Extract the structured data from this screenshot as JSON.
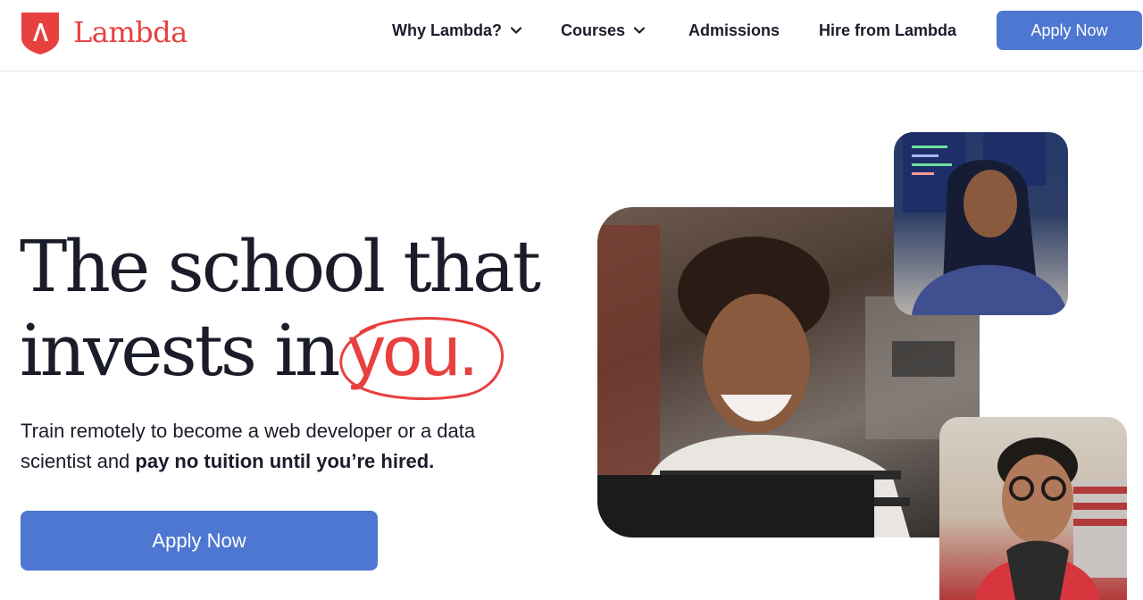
{
  "brand": {
    "name": "Lambda",
    "accent_color": "#e8403f",
    "button_color": "#4d77d0"
  },
  "nav": {
    "items": [
      {
        "label": "Why Lambda?",
        "has_dropdown": true
      },
      {
        "label": "Courses",
        "has_dropdown": true
      },
      {
        "label": "Admissions",
        "has_dropdown": false
      },
      {
        "label": "Hire from Lambda",
        "has_dropdown": false
      }
    ],
    "cta_label": "Apply Now"
  },
  "hero": {
    "title_line1": "The school that",
    "title_line2": "invests in",
    "title_highlight": "you.",
    "subtext_plain": "Train remotely to become a web developer or a data scientist and ",
    "subtext_bold": "pay no tuition until you’re hired.",
    "cta_label": "Apply Now"
  },
  "photos": [
    {
      "name": "student-laptop-photo"
    },
    {
      "name": "student-coding-photo"
    },
    {
      "name": "student-glasses-photo"
    }
  ]
}
